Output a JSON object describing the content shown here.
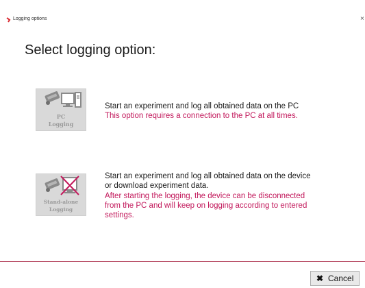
{
  "window": {
    "title": "Logging options",
    "close_glyph": "×"
  },
  "heading": "Select logging option:",
  "options": [
    {
      "tile_label": [
        "PC",
        "Logging"
      ],
      "description": [
        "Start an experiment and log all obtained data on the PC"
      ],
      "note": [
        "This option requires a connection to the PC at all times."
      ]
    },
    {
      "tile_label": [
        "Stand-alone",
        "Logging"
      ],
      "description": [
        "Start an experiment and log all obtained data on the device",
        "or download experiment data."
      ],
      "note": [
        "After starting the logging, the device can be disconnected",
        "from the PC and will keep on logging according to entered",
        "settings."
      ]
    }
  ],
  "footer": {
    "cancel_icon": "✖",
    "cancel_label": "Cancel"
  },
  "colors": {
    "accent": "#c2185b",
    "divider": "#b03a55",
    "tile_bg": "#d9d9d9",
    "tile_text": "#9a9a9a"
  }
}
